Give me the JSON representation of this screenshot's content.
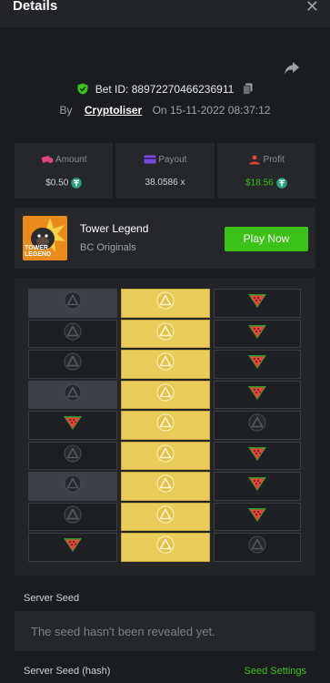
{
  "header": {
    "title": "Details",
    "close_label": "✕"
  },
  "bet": {
    "bet_id_label": "Bet ID: 88972270466236911",
    "by_label": "By",
    "user": "Cryptoliser",
    "on_label": "On",
    "datetime": "15-11-2022 08:37:12"
  },
  "stats": {
    "amount_label": "Amount",
    "amount_value": "$0.50",
    "payout_label": "Payout",
    "payout_value": "38.0586 x",
    "profit_label": "Profit",
    "profit_value": "$18.56"
  },
  "game": {
    "thumb_text": "TOWER LEGEND",
    "title": "Tower Legend",
    "subtitle": "BC Originals",
    "play_label": "Play Now"
  },
  "board": {
    "rows": [
      [
        "grey-pick",
        "gold-pick",
        "melon"
      ],
      [
        "dark-pick",
        "gold-pick",
        "melon"
      ],
      [
        "dark-pick",
        "gold-pick",
        "melon"
      ],
      [
        "grey-pick",
        "gold-pick",
        "melon"
      ],
      [
        "melon",
        "gold-pick",
        "dim-pick"
      ],
      [
        "dark-pick",
        "gold-pick",
        "melon"
      ],
      [
        "grey-pick",
        "gold-pick",
        "melon"
      ],
      [
        "dark-pick",
        "gold-pick",
        "melon"
      ],
      [
        "melon",
        "gold-pick",
        "dim-pick"
      ]
    ]
  },
  "seed": {
    "server_seed_label": "Server Seed",
    "server_seed_placeholder": "The seed hasn't been revealed yet.",
    "hash_label": "Server Seed (hash)",
    "settings_label": "Seed Settings"
  },
  "colors": {
    "accent_green": "#3bc117",
    "gold_tile": "#e9cc5a",
    "background": "#1a1c20"
  }
}
